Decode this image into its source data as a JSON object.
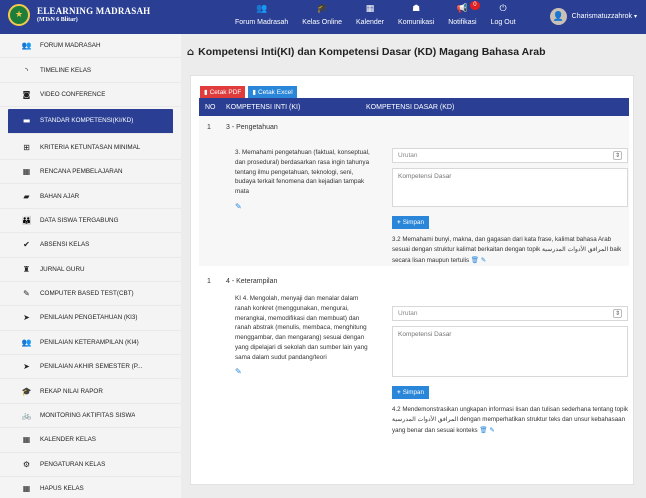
{
  "brand": {
    "title": "ELEARNING MADRASAH",
    "subtitle": "(MTsN 6 Blitar)"
  },
  "nav": [
    {
      "label": "Forum Madrasah",
      "icon": "users-icon"
    },
    {
      "label": "Kelas Online",
      "icon": "graduation-cap-icon"
    },
    {
      "label": "Kalender",
      "icon": "calendar-icon"
    },
    {
      "label": "Komunikasi",
      "icon": "chat-icon"
    },
    {
      "label": "Notifikasi",
      "icon": "bullhorn-icon",
      "badge": "0"
    },
    {
      "label": "Log Out",
      "icon": "power-icon"
    }
  ],
  "user": {
    "name": "Charismatuzzahrok"
  },
  "sidebar": {
    "items": [
      {
        "label": "FORUM MADRASAH",
        "icon": "users-icon"
      },
      {
        "label": "TIMELINE KELAS",
        "icon": "rss-icon"
      },
      {
        "label": "VIDEO CONFERENCE",
        "icon": "camera-icon"
      },
      {
        "label": "STANDAR KOMPETENSI(KI/KD)",
        "icon": "laptop-icon",
        "active": true
      },
      {
        "label": "KRITERIA KETUNTASAN MINIMAL",
        "icon": "sitemap-icon"
      },
      {
        "label": "RENCANA PEMBELAJARAN",
        "icon": "calendar-icon"
      },
      {
        "label": "BAHAN AJAR",
        "icon": "folder-icon"
      },
      {
        "label": "DATA SISWA TERGABUNG",
        "icon": "group-icon"
      },
      {
        "label": "ABSENSI KELAS",
        "icon": "check-icon"
      },
      {
        "label": "JURNAL GURU",
        "icon": "binoculars-icon"
      },
      {
        "label": "COMPUTER BASED TEST(CBT)",
        "icon": "edit-icon"
      },
      {
        "label": "PENILAIAN PENGETAHUAN (KI3)",
        "icon": "send-icon"
      },
      {
        "label": "PENILAIAN KETERAMPILAN (KI4)",
        "icon": "users-icon"
      },
      {
        "label": "PENILAIAN AKHIR SEMESTER (P...",
        "icon": "send-icon"
      },
      {
        "label": "REKAP NILAI RAPOR",
        "icon": "graduation-cap-icon"
      },
      {
        "label": "MONITORING AKTIFITAS SISWA",
        "icon": "bicycle-icon"
      },
      {
        "label": "KALENDER KELAS",
        "icon": "calendar-icon"
      },
      {
        "label": "PENGATURAN KELAS",
        "icon": "gear-icon"
      },
      {
        "label": "HAPUS KELAS",
        "icon": "calendar-icon"
      }
    ]
  },
  "main": {
    "title": "Kompetensi Inti(KI) dan Kompetensi Dasar (KD) Magang Bahasa Arab",
    "buttons": {
      "pdf": "Cetak PDF",
      "excel": "Cetak Excel"
    },
    "table": {
      "headers": {
        "no": "NO",
        "ki": "KOMPETENSI INTI (KI)",
        "kd": "KOMPETENSI DASAR (KD)"
      },
      "rows": [
        {
          "no": "1",
          "label": "3 - Pengetahuan",
          "ki_text": "3. Memahami pengetahuan (faktual, konseptual, dan prosedural) berdasarkan rasa ingin tahunya tentang ilmu pengetahuan, teknologi, seni, budaya terkait fenomena dan kejadian tampak mata",
          "urutan_placeholder": "Urutan",
          "kd_placeholder": "Kompetensi Dasar",
          "simpan": "Simpan",
          "kd_text": "3.2 Memahami bunyi, makna, dan gagasan dari kata frase, kalimat bahasa Arab sesuai dengan struktur kalimat berkaitan dengan topik المرافق الأدوات المدرسية baik secara lisan maupun tertulis"
        },
        {
          "no": "1",
          "label": "4 - Keterampilan",
          "ki_text": "KI 4. Mengolah, menyaji dan menalar dalam ranah konkret (menggunakan, mengurai, merangkai, memodifikasi dan membuat) dan ranah abstrak (menulis, membaca, menghitung menggambar, dan mengarang) sesuai dengan yang dipelajari di sekolah dan sumber lain yang sama dalam sudut pandang/teori",
          "urutan_placeholder": "Urutan",
          "kd_placeholder": "Kompetensi Dasar",
          "simpan": "Simpan",
          "kd_text": "4.2 Mendemonstrasikan ungkapan informasi lisan dan tulisan sederhana tentang topik المرافق الأدوات المدرسية dengan memperhatikan struktur teks dan unsur kebahasaan yang benar dan sesuai konteks"
        }
      ]
    }
  }
}
